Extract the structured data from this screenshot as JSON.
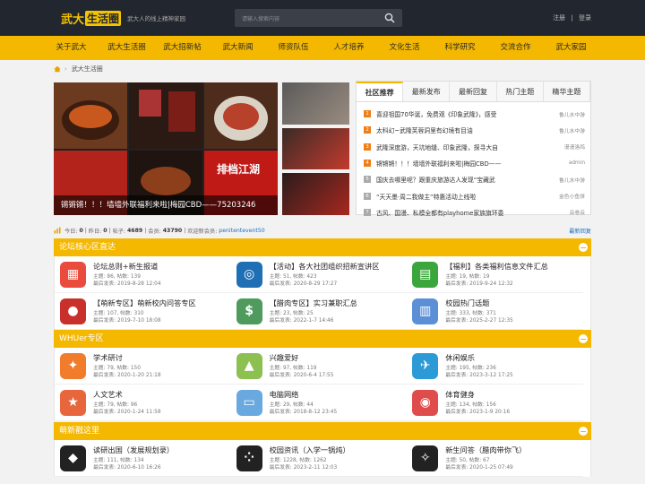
{
  "header": {
    "logo_a": "武大",
    "logo_b": "生活圈",
    "slogan": "武大人的线上精神家园",
    "search_placeholder": "请输入搜索内容",
    "register": "注册",
    "divider": "|",
    "login": "登录"
  },
  "nav": [
    "关于武大",
    "武大生活圈",
    "武大招新帖",
    "武大新闻",
    "师资队伍",
    "人才培养",
    "文化生活",
    "科学研究",
    "交流合作",
    "武大家园"
  ],
  "breadcrumb": {
    "sep": "›",
    "current": "武大生活圈"
  },
  "slider": {
    "caption": "锵锵锵！！！墙墙外联福利来啦|梅园CBD——75203246",
    "sign_text": "排档江湖"
  },
  "tabs": {
    "labels": [
      "社区推荐",
      "最新发布",
      "最新回复",
      "热门主题",
      "精华主题"
    ],
    "items": [
      {
        "n": "1",
        "title": "喜迎祖国70华诞，免费观《印象武隆》，感受",
        "author": "鲁儿水中游"
      },
      {
        "n": "2",
        "title": "太科幻~武隆芙蓉洞里有幻境有目油",
        "author": "鲁儿水中游"
      },
      {
        "n": "3",
        "title": "武隆深度游，天坑地缝、印象武隆，探寻大自",
        "author": "漫漫洛鸣"
      },
      {
        "n": "4",
        "title": "锵锵锵！！！墙墙外联福利来啦|梅园CBD——",
        "author": "admin"
      },
      {
        "n": "5",
        "title": "国庆去哪里呢？跟重庆旅游达人发现“宝藏武",
        "author": "鲁儿水中游"
      },
      {
        "n": "6",
        "title": "“天天墨·周二我做主”特惠活动上线啦",
        "author": "金色小鱼饼"
      },
      {
        "n": "7",
        "title": "古风、国漫、私模全都有playhome家族旗环委",
        "author": "云卷云"
      }
    ]
  },
  "stats": {
    "today_label": "今日:",
    "today": "0",
    "yesterday_label": "昨日:",
    "yesterday": "0",
    "posts_label": "帖子:",
    "posts": "4689",
    "members_label": "会员:",
    "members": "43790",
    "welcome": "欢迎新会员:",
    "newuser": "penitentevent50",
    "newest": "最新回复"
  },
  "sections": [
    {
      "title": "论坛核心区直达",
      "forums": [
        {
          "name": "论坛总则+新生报道",
          "m1": "主题: 86, 帖数: 139",
          "m2": "最后发表: 2019-8-28 12:04",
          "icon": "calendar-icon",
          "color": "#e94b3c"
        },
        {
          "name": "【活动】各大社团组织招新宣讲区",
          "m1": "主题: 51, 帖数: 423",
          "m2": "最后发表: 2020-8-29 17:27",
          "icon": "lifebuoy-icon",
          "color": "#1f6fb5"
        },
        {
          "name": "【福利】各类福利信息文件汇总",
          "m1": "主题: 19, 帖数: 19",
          "m2": "最后发表: 2019-9-24 12:32",
          "icon": "folder-icon",
          "color": "#3aa63c"
        },
        {
          "name": "【萌新专区】萌新校内问答专区",
          "m1": "主题: 107, 帖数: 310",
          "m2": "最后发表: 2019-7-10 18:08",
          "icon": "angry-bird-icon",
          "color": "#c9302c"
        },
        {
          "name": "【腊肉专区】实习兼职汇总",
          "m1": "主题: 23, 帖数: 25",
          "m2": "最后发表: 2022-1-7 14:46",
          "icon": "money-icon",
          "color": "#4f9a5d"
        },
        {
          "name": "校园热门话题",
          "m1": "主题: 333, 帖数: 371",
          "m2": "最后发表: 2025-2-27 12:35",
          "icon": "document-icon",
          "color": "#5b8fd6"
        }
      ]
    },
    {
      "title": "WHUer专区",
      "forums": [
        {
          "name": "学术研讨",
          "m1": "主题: 79, 帖数: 150",
          "m2": "最后发表: 2020-1-20 21:18",
          "icon": "compass-icon",
          "color": "#f07c2c"
        },
        {
          "name": "兴趣爱好",
          "m1": "主题: 97, 帖数: 119",
          "m2": "最后发表: 2020-6-4 17:55",
          "icon": "landscape-icon",
          "color": "#8cc152"
        },
        {
          "name": "休闲娱乐",
          "m1": "主题: 195, 帖数: 236",
          "m2": "最后发表: 2023-3-12 17:25",
          "icon": "plane-icon",
          "color": "#2d9ad8"
        },
        {
          "name": "人文艺术",
          "m1": "主题: 79, 帖数: 96",
          "m2": "最后发表: 2020-1-24 11:58",
          "icon": "star-icon",
          "color": "#e8663c"
        },
        {
          "name": "电脑网络",
          "m1": "主题: 29, 帖数: 44",
          "m2": "最后发表: 2018-8-12 23:45",
          "icon": "computer-icon",
          "color": "#6aa9e0"
        },
        {
          "name": "体育健身",
          "m1": "主题: 134, 帖数: 156",
          "m2": "最后发表: 2023-1-9 20:16",
          "icon": "camera-icon",
          "color": "#e04b4b"
        }
      ]
    },
    {
      "title": "萌新戳这里",
      "forums": [
        {
          "name": "读研出国（发展规划录）",
          "m1": "主题: 111, 帖数: 134",
          "m2": "最后发表: 2020-6-10 16:26",
          "icon": "app-icon",
          "color": "#222222"
        },
        {
          "name": "校园资讯（入学一锅炖）",
          "m1": "主题: 1228, 帖数: 1262",
          "m2": "最后发表: 2023-2-11 12:03",
          "icon": "dots-icon",
          "color": "#222222"
        },
        {
          "name": "新生问答（腊肉带你飞）",
          "m1": "主题: 50, 帖数: 67",
          "m2": "最后发表: 2020-1-25 07:49",
          "icon": "sparkle-icon",
          "color": "#222222"
        }
      ]
    }
  ]
}
